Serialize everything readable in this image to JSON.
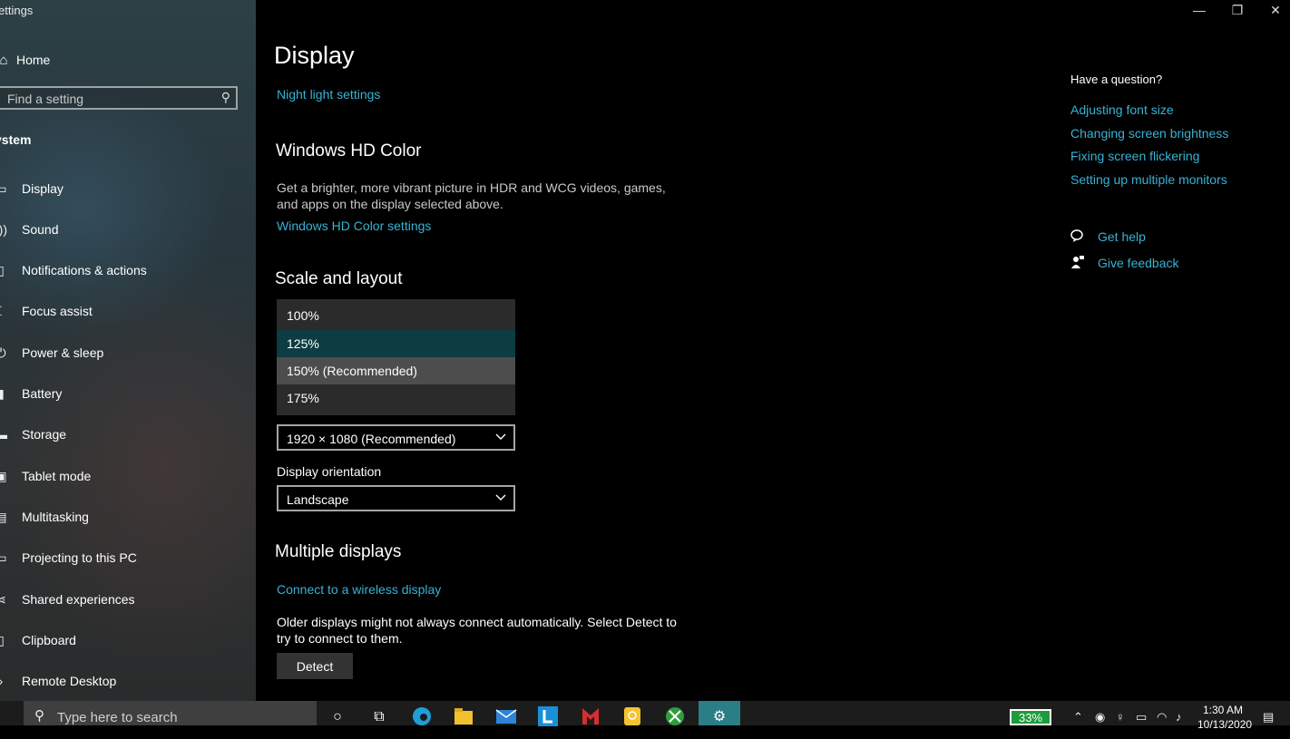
{
  "window": {
    "title": "ettings",
    "controls": {
      "minimize": "—",
      "restore": "❐",
      "close": "✕"
    }
  },
  "sidebar": {
    "home_label": "Home",
    "search_placeholder": "Find a setting",
    "section_heading": "ystem",
    "items": [
      {
        "label": "Display",
        "icon": "monitor-icon"
      },
      {
        "label": "Sound",
        "icon": "speaker-icon"
      },
      {
        "label": "Notifications & actions",
        "icon": "notification-icon"
      },
      {
        "label": "Focus assist",
        "icon": "moon-icon"
      },
      {
        "label": "Power & sleep",
        "icon": "power-icon"
      },
      {
        "label": "Battery",
        "icon": "battery-icon"
      },
      {
        "label": "Storage",
        "icon": "storage-icon"
      },
      {
        "label": "Tablet mode",
        "icon": "tablet-icon"
      },
      {
        "label": "Multitasking",
        "icon": "multitasking-icon"
      },
      {
        "label": "Projecting to this PC",
        "icon": "project-icon"
      },
      {
        "label": "Shared experiences",
        "icon": "share-icon"
      },
      {
        "label": "Clipboard",
        "icon": "clipboard-icon"
      },
      {
        "label": "Remote Desktop",
        "icon": "remote-desktop-icon"
      }
    ]
  },
  "main": {
    "title": "Display",
    "night_light_link": "Night light settings",
    "hd_color": {
      "heading": "Windows HD Color",
      "desc_line1": "Get a brighter, more vibrant picture in HDR and WCG videos, games,",
      "desc_line2": "and apps on the display selected above.",
      "link": "Windows HD Color settings"
    },
    "scale_layout": {
      "heading": "Scale and layout",
      "scale_options": [
        "100%",
        "125%",
        "150% (Recommended)",
        "175%"
      ],
      "scale_selected": "125%",
      "scale_highlighted": "150% (Recommended)",
      "resolution_value": "1920 × 1080 (Recommended)",
      "orientation_label": "Display orientation",
      "orientation_value": "Landscape"
    },
    "multiple_displays": {
      "heading": "Multiple displays",
      "link": "Connect to a wireless display",
      "desc_line1": "Older displays might not always connect automatically. Select Detect to",
      "desc_line2": "try to connect to them.",
      "detect_label": "Detect"
    }
  },
  "right": {
    "question_heading": "Have a question?",
    "links": [
      "Adjusting font size",
      "Changing screen brightness",
      "Fixing screen flickering",
      "Setting up multiple monitors"
    ],
    "get_help": "Get help",
    "give_feedback": "Give feedback"
  },
  "taskbar": {
    "search_placeholder": "Type here to search",
    "apps": [
      "cortana-icon",
      "task-view-icon",
      "edge-icon",
      "file-explorer-icon",
      "mail-icon",
      "l-app-icon",
      "mcafee-icon",
      "tips-icon",
      "xbox-icon",
      "settings-icon"
    ],
    "battery_percent": "33%",
    "time": "1:30 AM",
    "date": "10/13/2020",
    "accent": "#2b7d86"
  },
  "colors": {
    "link": "#36b3d4",
    "selected_option": "#0d3d42",
    "hover_option": "#4d4d4d"
  }
}
